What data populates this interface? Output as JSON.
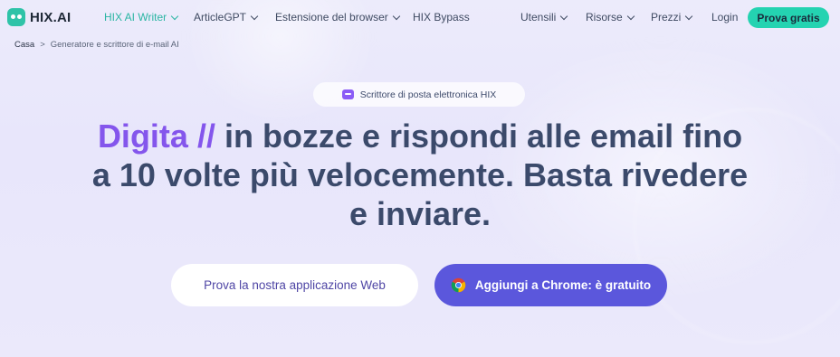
{
  "brand": {
    "name": "HIX.AI"
  },
  "nav": {
    "items": [
      {
        "label": "HIX AI Writer",
        "has_dropdown": true,
        "active": true
      },
      {
        "label": "ArticleGPT",
        "has_dropdown": true,
        "active": false
      },
      {
        "label": "Estensione del browser",
        "has_dropdown": true,
        "active": false
      },
      {
        "label": "HIX Bypass",
        "has_dropdown": false,
        "active": false
      },
      {
        "label": "Utensili",
        "has_dropdown": true,
        "active": false
      },
      {
        "label": "Risorse",
        "has_dropdown": true,
        "active": false
      },
      {
        "label": "Prezzi",
        "has_dropdown": true,
        "active": false
      }
    ],
    "login_label": "Login",
    "cta_label": "Prova gratis"
  },
  "breadcrumb": {
    "home": "Casa",
    "separator": ">",
    "current": "Generatore e scrittore di e-mail AI"
  },
  "hero": {
    "badge": "Scrittore di posta elettronica HIX",
    "headline_highlight": "Digita //",
    "headline_rest": " in bozze e rispondi alle email fino a 10 volte più velocemente. Basta rivedere e inviare.",
    "cta_web": "Prova la nostra applicazione Web",
    "cta_chrome": "Aggiungi a Chrome: è gratuito"
  },
  "colors": {
    "accent_teal": "#24d3b1",
    "accent_purple": "#8456ec",
    "cta_primary": "#5b57dc",
    "text_dark": "#3b4a6b"
  },
  "icons": [
    "logo-icon",
    "chevron-down-icon",
    "chat-bubble-icon",
    "chrome-icon"
  ]
}
